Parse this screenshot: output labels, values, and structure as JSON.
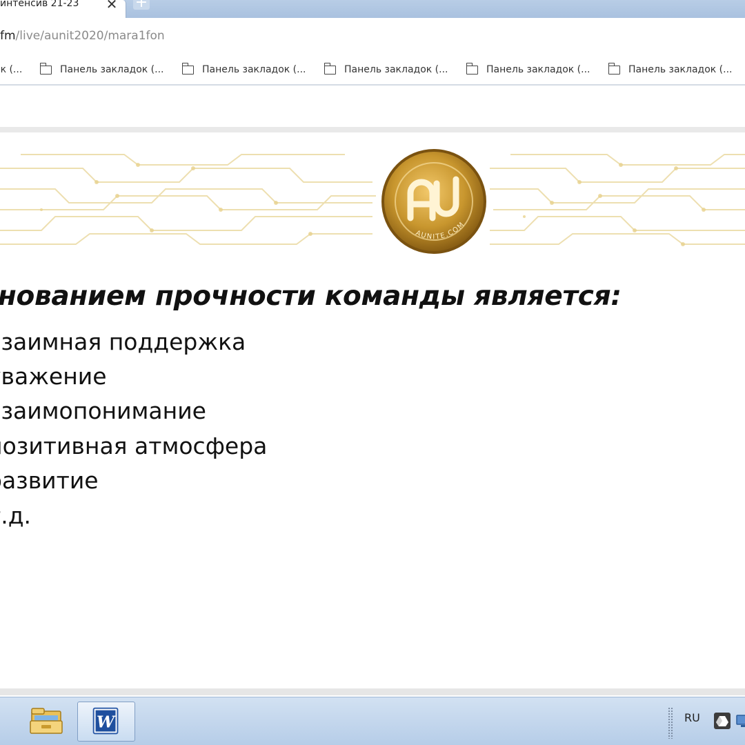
{
  "browser": {
    "tab": {
      "title": "интенсив 21-23",
      "close_glyph": "✕"
    },
    "newtab_glyph": "+",
    "address": {
      "host": "fm",
      "path": "/live/aunit2020/mara1fon"
    },
    "bookmarks": [
      {
        "label": "ок (...",
        "icon": "folder-icon"
      },
      {
        "label": "Панель закладок (...",
        "icon": "folder-icon"
      },
      {
        "label": "Панель закладок (...",
        "icon": "folder-icon"
      },
      {
        "label": "Панель закладок (...",
        "icon": "folder-icon"
      },
      {
        "label": "Панель закладок (...",
        "icon": "folder-icon"
      },
      {
        "label": "Панель закладок (...",
        "icon": "folder-icon"
      }
    ]
  },
  "slide": {
    "logo": {
      "monogram": "AU",
      "ring_text": "AUNITE.COM",
      "gold": "#c8962e"
    },
    "heading": "снованием прочности команды является:",
    "items": [
      "взаимная поддержка",
      "уважение",
      "взаимопонимание",
      "позитивная атмосфера",
      "развитие",
      "т.д."
    ]
  },
  "taskbar": {
    "apps": [
      {
        "name": "explorer",
        "icon": "folder-explorer-icon"
      },
      {
        "name": "word",
        "icon": "word-icon",
        "glyph": "W"
      }
    ],
    "language": "RU",
    "tray_icons": [
      "google-drive-icon",
      "network-icon"
    ]
  }
}
